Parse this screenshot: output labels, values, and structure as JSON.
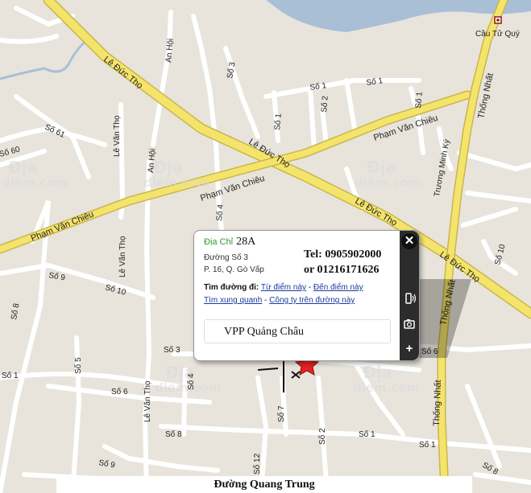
{
  "map": {
    "landmark": "Cầu Tử Quý",
    "roads": {
      "le_duc_tho": "Lê Đức Thọ",
      "pham_van_chieu": "Phạm Văn Chiêu",
      "thong_nhat": "Thống Nhất",
      "le_van_tho": "Lê Văn Thọ",
      "an_hoi": "An Hội",
      "truong_minh_ky": "Trương Minh Ký"
    },
    "streets": {
      "so1": "Số 1",
      "so2": "Số 2",
      "so3": "Số 3",
      "so4": "Số 4",
      "so5": "Số 5",
      "so6": "Số 6",
      "so7": "Số 7",
      "so8": "Số 8",
      "so9": "Số 9",
      "so10": "Số 10",
      "so12": "Số 12",
      "so60": "Số 60",
      "so61": "Số 61"
    },
    "watermark_line1": "Địa",
    "watermark_line2": "diem.com",
    "colors": {
      "background": "#e8e4dc",
      "major_road": "#f4e46c",
      "minor_road": "#ffffff",
      "water": "#a9bfd6",
      "marker": "#e52222"
    }
  },
  "popup": {
    "address_label": "Địa Chỉ",
    "address_number": "28A",
    "street": "Đường Số 3",
    "ward_district": "P. 16, Q. Gò Vấp",
    "tel_line": "Tel: 0905902000",
    "or_line": "or 01216171626",
    "directions_label": "Tìm đường đi:",
    "from_here": "Từ điểm này",
    "to_here": "Đến điểm này",
    "nearby_link": "Tìm xung quanh",
    "companies_link": "Công ty trên đường này",
    "business_name": "VPP Quảng Châu",
    "icons": {
      "close": "close-icon",
      "phone": "phone-icon",
      "camera": "camera-icon",
      "add": "plus-icon"
    }
  },
  "bottom_bar": {
    "text": "Đường Quang Trung"
  }
}
